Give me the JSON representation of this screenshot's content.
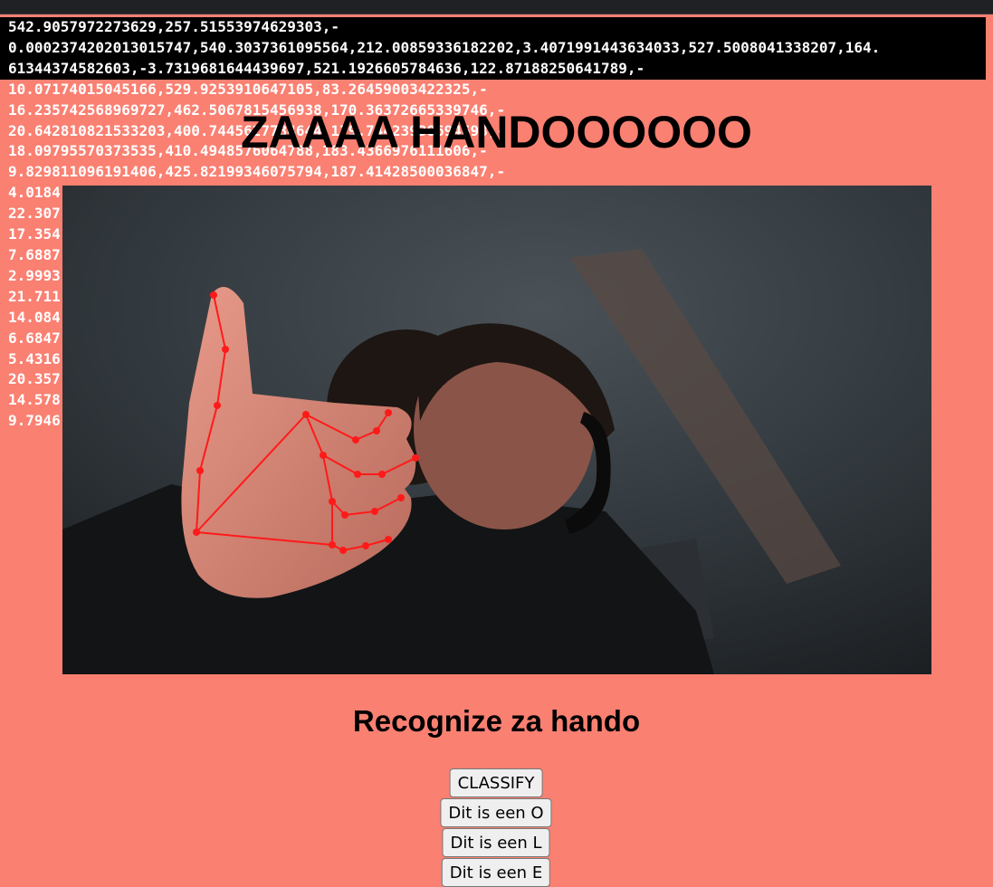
{
  "page": {
    "title": "ZAAAA HANDOOOOOO",
    "subtitle": "Recognize za hando"
  },
  "log_lines": [
    "542.9057972273629,257.51553974629303,-",
    "0.0002374202013015747,540.3037361095564,212.00859336182202,3.4071991443634033,527.5008041338207,164.",
    "61344374582603,-3.7319681644439697,521.1926605784636,122.87188250641789,-",
    "10.07174015045166,529.9253910647105,83.26459003422325,-",
    "16.235742568969727,462.5067815456938,170.36372665339746,-",
    "20.642810821533203,400.7445627734644,179.74423938694698,-",
    "18.09795570373535,410.4948576064788,183.4366976111606,-",
    "9.829811096191406,425.82199346075794,187.41428500036847,-",
    "4.0184",
    "22.307",
    "17.354",
    "7.6887",
    "2.9993",
    "21.711",
    "14.084",
    "6.6847",
    "5.4316",
    "20.357",
    "14.578",
    "9.7946"
  ],
  "buttons": {
    "classify": "CLASSIFY",
    "label_o": "Dit is een O",
    "label_l": "Dit is een L",
    "label_e": "Dit is een E"
  },
  "colors": {
    "background": "#fa8072",
    "landmark": "#ff1a1a",
    "button_bg": "#efefef"
  }
}
